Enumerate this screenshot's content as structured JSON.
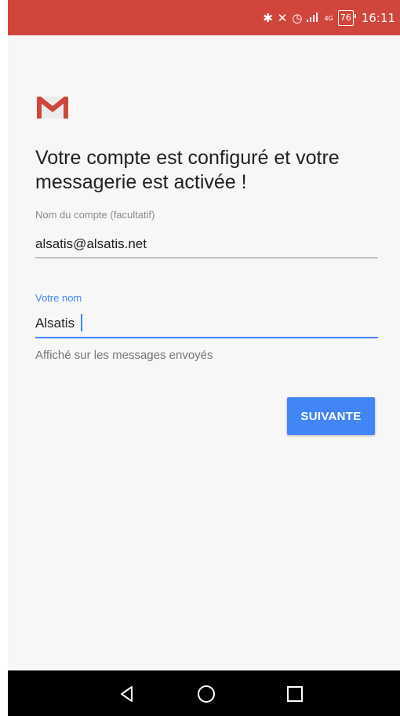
{
  "status_bar": {
    "icons": [
      "bluetooth-icon",
      "mute-icon",
      "alarm-icon",
      "signal-icon",
      "4g-icon",
      "battery-icon"
    ],
    "battery_level": "76",
    "network_type": "4G",
    "time": "16:11",
    "color": "#d0463c"
  },
  "header": {
    "logo": "gmail-logo",
    "title": "Votre compte est configuré et votre messagerie est activée !"
  },
  "form": {
    "account_name": {
      "label": "Nom du compte (facultatif)",
      "value": "alsatis@alsatis.net"
    },
    "your_name": {
      "label": "Votre nom",
      "value": "Alsatis",
      "helper": "Affiché sur les messages envoyés"
    },
    "accent_color": "#4285f4"
  },
  "actions": {
    "next_label": "SUIVANTE"
  },
  "nav_bar": {
    "buttons": [
      "back-icon",
      "home-icon",
      "recents-icon"
    ]
  }
}
